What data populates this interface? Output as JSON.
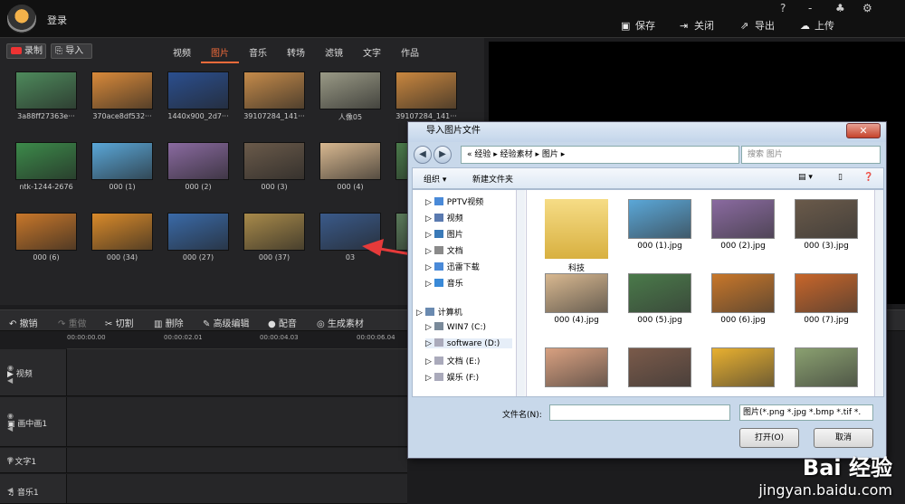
{
  "app": {
    "login": "登录",
    "window_controls": [
      "?",
      "-",
      "♣",
      "⚙"
    ],
    "top_buttons": [
      {
        "icon": "save-icon",
        "label": "保存"
      },
      {
        "icon": "close-door-icon",
        "label": "关闭"
      },
      {
        "icon": "export-icon",
        "label": "导出"
      },
      {
        "icon": "upload-cloud-icon",
        "label": "上传"
      }
    ]
  },
  "library": {
    "record_label": "录制",
    "import_label": "导入",
    "tabs": [
      {
        "label": "视频",
        "active": false
      },
      {
        "label": "图片",
        "active": true
      },
      {
        "label": "音乐",
        "active": false
      },
      {
        "label": "转场",
        "active": false
      },
      {
        "label": "滤镜",
        "active": false
      },
      {
        "label": "文字",
        "active": false
      },
      {
        "label": "作品",
        "active": false
      }
    ],
    "items": [
      {
        "name": "3a88ff27363e···",
        "color": "#4e8a5c"
      },
      {
        "name": "370ace8df532···",
        "color": "#d98a3a"
      },
      {
        "name": "1440x900_2d7···",
        "color": "#2b4f8f"
      },
      {
        "name": "39107284_141···",
        "color": "#c58b4a"
      },
      {
        "name": "人像05",
        "color": "#9a9a86"
      },
      {
        "name": "39107284_141···",
        "color": "#c9873f"
      },
      {
        "name": "ntk-1244-2676",
        "color": "#3c8a4a"
      },
      {
        "name": "000 (1)",
        "color": "#5aa7d8"
      },
      {
        "name": "000 (2)",
        "color": "#8a6aa0"
      },
      {
        "name": "000 (3)",
        "color": "#6a5a4a"
      },
      {
        "name": "000 (4)",
        "color": "#d8b890"
      },
      {
        "name": "000 (5)",
        "color": "#4a7a4a"
      },
      {
        "name": "000 (6)",
        "color": "#c8772a"
      },
      {
        "name": "000 (34)",
        "color": "#d98a2a"
      },
      {
        "name": "000 (27)",
        "color": "#3a6aa8"
      },
      {
        "name": "000 (37)",
        "color": "#a88a4a"
      },
      {
        "name": "03",
        "color": "#3a5a8a"
      },
      {
        "name": "",
        "color": "#5a7a5a"
      }
    ]
  },
  "timeline": {
    "tools": [
      {
        "label": "撤销",
        "dim": false
      },
      {
        "label": "重做",
        "dim": true
      },
      {
        "label": "切割",
        "dim": false
      },
      {
        "label": "删除",
        "dim": false
      },
      {
        "label": "高级编辑",
        "dim": false
      },
      {
        "label": "配音",
        "dim": false
      },
      {
        "label": "生成素材",
        "dim": false
      }
    ],
    "ruler": [
      "00:00:00.00",
      "00:00:02.01",
      "00:00:04.03",
      "00:00:06.04"
    ],
    "tracks": [
      {
        "label": "视频"
      },
      {
        "label": "画中画1"
      },
      {
        "label": "文字1"
      },
      {
        "label": "音乐1"
      }
    ]
  },
  "dialog": {
    "title": "导入图片文件",
    "close": "✕",
    "breadcrumb": "« 经验 ▸ 经验素材 ▸ 图片 ▸",
    "search_placeholder": "搜索 图片",
    "organize": "组织 ▾",
    "new_folder": "新建文件夹",
    "tree": [
      {
        "label": "PPTV视频"
      },
      {
        "label": "视频"
      },
      {
        "label": "图片"
      },
      {
        "label": "文档"
      },
      {
        "label": "迅雷下载"
      },
      {
        "label": "音乐"
      },
      {
        "label": "计算机"
      },
      {
        "label": "WIN7 (C:)"
      },
      {
        "label": "software (D:)"
      },
      {
        "label": "文档 (E:)"
      },
      {
        "label": "娱乐 (F:)"
      }
    ],
    "files": [
      {
        "name": "科技",
        "color": "#e8c860"
      },
      {
        "name": "000 (1).jpg",
        "color": "#5aa7d8"
      },
      {
        "name": "000 (2).jpg",
        "color": "#8a6aa0"
      },
      {
        "name": "000 (3).jpg",
        "color": "#6a5a4a"
      },
      {
        "name": "000 (4).jpg",
        "color": "#d8b890"
      },
      {
        "name": "000 (5).jpg",
        "color": "#4a7a4a"
      },
      {
        "name": "000 (6).jpg",
        "color": "#c8772a"
      },
      {
        "name": "000 (7).jpg",
        "color": "#c8662a"
      },
      {
        "name": "",
        "color": "#d8a080"
      },
      {
        "name": "",
        "color": "#7a5a4a"
      },
      {
        "name": "",
        "color": "#e8b030"
      },
      {
        "name": "",
        "color": "#8aa070"
      }
    ],
    "filename_label": "文件名(N):",
    "filetype": "图片(*.png *.jpg *.bmp *.tif *.",
    "open_btn": "打开(O)",
    "cancel_btn": "取消"
  },
  "watermark": {
    "line1": "Bai 经验",
    "line2": "jingyan.baidu.com"
  }
}
